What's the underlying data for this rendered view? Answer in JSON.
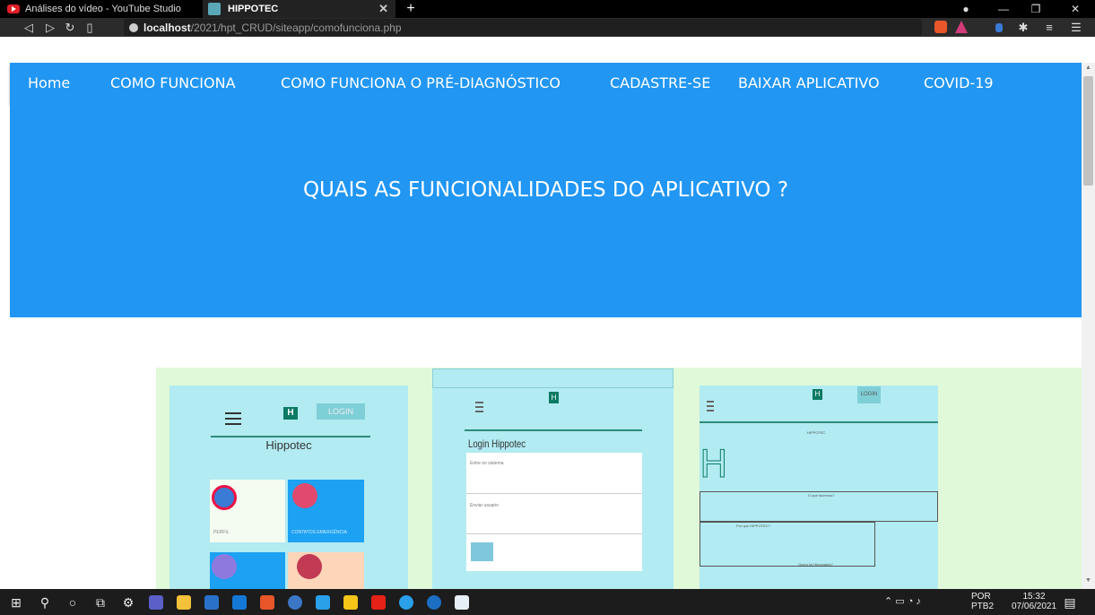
{
  "browser": {
    "tabs": [
      {
        "label": "Análises do vídeo - YouTube Studio",
        "active": false
      },
      {
        "label": "HIPPOTEC",
        "active": true
      }
    ],
    "new_tab": "+",
    "url_host": "localhost",
    "url_path": "/2021/hpt_CRUD/siteapp/comofunciona.php"
  },
  "nav": {
    "items": [
      "Home",
      "COMO FUNCIONA",
      "COMO FUNCIONA O PRÉ-DIAGNÓSTICO",
      "CADASTRE-SE",
      "BAIXAR APLICATIVO",
      "COVID-19"
    ]
  },
  "hero": {
    "title": "QUAIS AS FUNCIONALIDADES DO APLICATIVO ?"
  },
  "shots": {
    "s1": {
      "login": "LOGIN",
      "brand": "Hippotec",
      "tile1": "PERFIL",
      "tile2": "CONTATOS EMERGÊNCIA"
    },
    "s2": {
      "title": "Login Hippotec",
      "field1": "Entre no sistema",
      "field2": "Enviar usuario"
    },
    "s3": {
      "login": "LOGIN",
      "header": "HIPPOTEC",
      "q1": "O que fazemos?",
      "q2": "Por que HIPPOTEC?",
      "q3": "Quem foi Hipócrates?"
    }
  },
  "taskbar": {
    "lang1": "POR",
    "lang2": "PTB2",
    "time": "15:32",
    "date": "07/06/2021"
  },
  "colors": {
    "primary": "#2196f3",
    "gallery_bg": "#e0f9d9",
    "screenshot_bg": "#b2ebf2"
  }
}
